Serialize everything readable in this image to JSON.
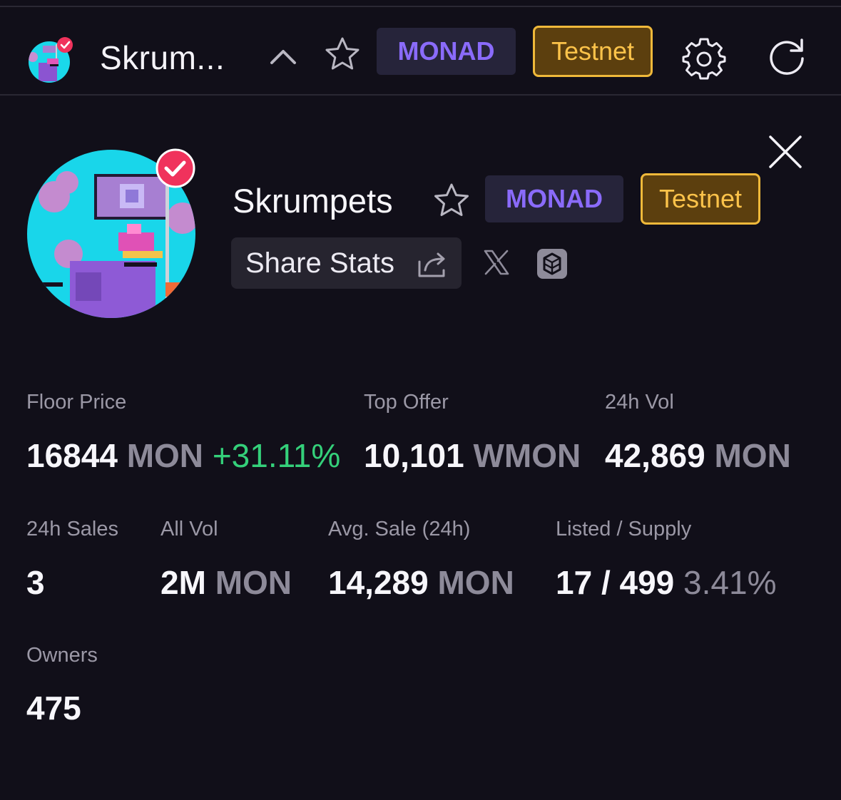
{
  "header": {
    "title": "Skrum...",
    "chain_badge": "MONAD",
    "network_badge": "Testnet"
  },
  "collection": {
    "name": "Skrumpets",
    "chain_badge": "MONAD",
    "network_badge": "Testnet",
    "share_label": "Share Stats"
  },
  "stats": {
    "floor": {
      "label": "Floor Price",
      "value": "16844",
      "unit": "MON",
      "change": "+31.11%"
    },
    "top_offer": {
      "label": "Top Offer",
      "value": "10,101",
      "unit": "WMON"
    },
    "vol_24h": {
      "label": "24h Vol",
      "value": "42,869",
      "unit": "MON"
    },
    "sales_24h": {
      "label": "24h Sales",
      "value": "3"
    },
    "all_vol": {
      "label": "All Vol",
      "value": "2M",
      "unit": "MON"
    },
    "avg_sale": {
      "label": "Avg. Sale (24h)",
      "value": "14,289",
      "unit": "MON"
    },
    "listed": {
      "label": "Listed / Supply",
      "value": "17 / 499",
      "percent": "3.41%"
    },
    "owners": {
      "label": "Owners",
      "value": "475"
    }
  },
  "icons": {
    "header": [
      "collection-avatar",
      "verified-badge-icon",
      "chevron-up-icon",
      "star-icon",
      "gear-icon",
      "refresh-icon"
    ],
    "profile": [
      "close-icon",
      "star-icon",
      "share-icon",
      "x-logo-icon",
      "cube-logo-icon"
    ]
  },
  "colors": {
    "background": "#110f19",
    "monad_text": "#8a6bfa",
    "monad_bg": "#26243a",
    "testnet_text": "#fcc34a",
    "testnet_border": "#f0b93a",
    "testnet_bg": "#5c3f0e",
    "positive": "#34d07a",
    "verified": "#f0325c"
  }
}
